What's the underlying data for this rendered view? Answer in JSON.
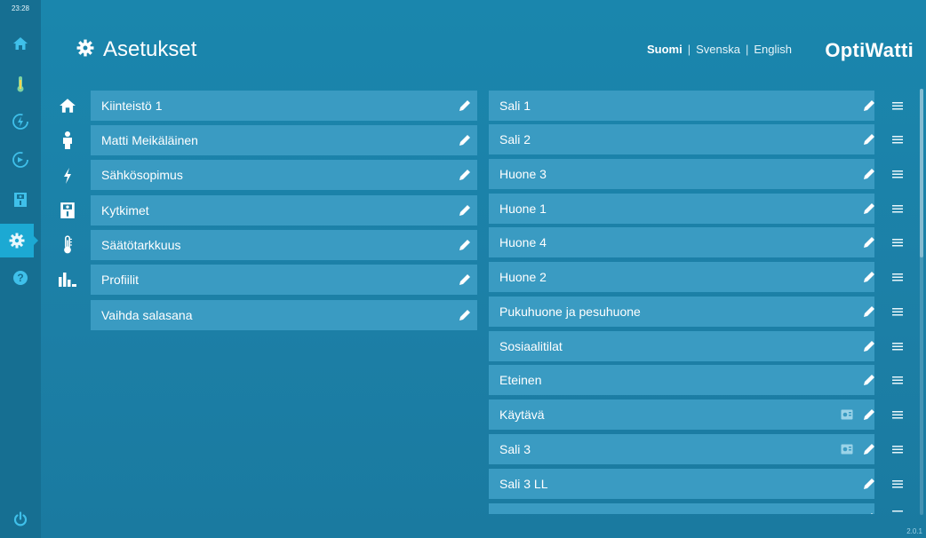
{
  "clock": "23:28",
  "rail": {
    "items": [
      {
        "icon": "home-icon"
      },
      {
        "icon": "thermometer-icon"
      },
      {
        "icon": "energy-icon"
      },
      {
        "icon": "gauge-icon"
      },
      {
        "icon": "switch-icon"
      },
      {
        "icon": "gear-icon",
        "active": true
      },
      {
        "icon": "help-icon"
      }
    ],
    "power_icon": "power-icon"
  },
  "header": {
    "title": "Asetukset",
    "languages": {
      "fi": "Suomi",
      "sep1": "|",
      "sv": "Svenska",
      "sep2": "|",
      "en": "English"
    },
    "brand": "OptiWatti"
  },
  "settings": [
    {
      "label": "Kiinteistö 1",
      "icon": "home-icon"
    },
    {
      "label": "Matti Meikäläinen",
      "icon": "person-icon"
    },
    {
      "label": "Sähkösopimus",
      "icon": "lightning-icon"
    },
    {
      "label": "Kytkimet",
      "icon": "switch-icon"
    },
    {
      "label": "Säätötarkkuus",
      "icon": "thermometer-icon"
    },
    {
      "label": "Profiilit",
      "icon": "bar-chart-icon"
    },
    {
      "label": "Vaihda salasana",
      "icon": ""
    }
  ],
  "rooms": [
    {
      "label": "Sali 1"
    },
    {
      "label": "Sali 2"
    },
    {
      "label": "Huone 3"
    },
    {
      "label": "Huone 1"
    },
    {
      "label": "Huone 4"
    },
    {
      "label": "Huone 2"
    },
    {
      "label": "Pukuhuone ja pesuhuone"
    },
    {
      "label": "Sosiaalitilat"
    },
    {
      "label": "Eteinen"
    },
    {
      "label": "Käytävä",
      "extra": true
    },
    {
      "label": "Sali 3",
      "extra": true
    },
    {
      "label": "Sali 3 LL"
    },
    {
      "label": ""
    }
  ],
  "version": "2.0.1",
  "colors": {
    "background": "#1e7fa3",
    "rail": "#166f92",
    "row": "#3a9bc2",
    "active": "#1ca9d3"
  }
}
